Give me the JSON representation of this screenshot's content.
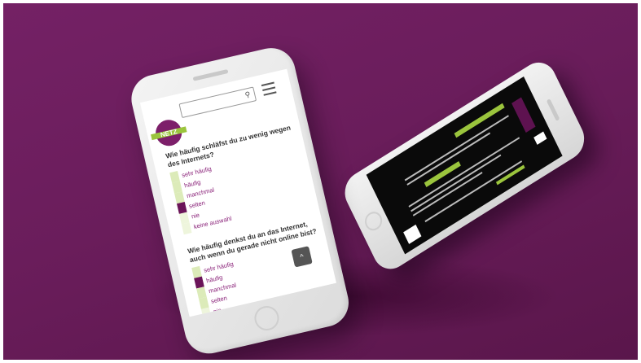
{
  "header": {
    "logo_text": "NETZ",
    "search_placeholder": "",
    "menu_icon": "hamburger-icon",
    "search_icon": "magnifier-icon"
  },
  "questions": [
    {
      "text": "Wie häufig schläfst du zu wenig wegen des Internets?",
      "options": [
        "sehr häufig",
        "häufig",
        "manchmal",
        "selten",
        "nie",
        "keine auswahl"
      ],
      "selected": "manchmal"
    },
    {
      "text": "Wie häufig denkst du an das Internet, auch wenn du gerade nicht online bist?",
      "options": [
        "sehr häufig",
        "häufig",
        "manchmal",
        "selten",
        "nie",
        "keine auswahl"
      ],
      "selected": "häufig"
    }
  ],
  "scroll_top": {
    "icon": "chevron-up-icon",
    "glyph": "^"
  },
  "colors": {
    "background": "#6a1d5b",
    "accent": "#8a2279",
    "selected": "#6b1559",
    "option_bar": "#dcebb9",
    "brand_green": "#9bc53d"
  }
}
